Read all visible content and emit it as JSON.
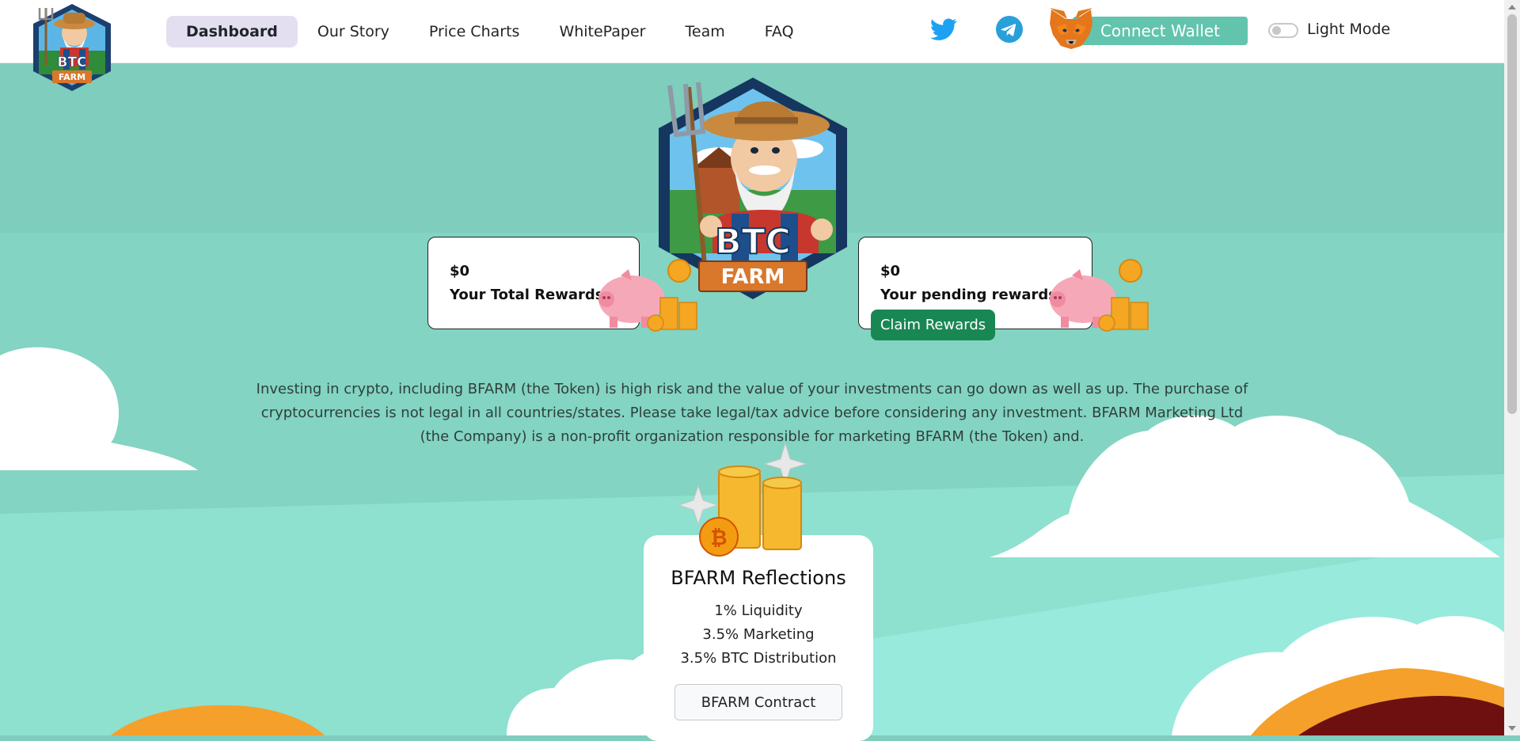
{
  "header": {
    "logo_text": {
      "line1": "BTC",
      "line2": "FARM"
    },
    "nav": [
      {
        "label": "Dashboard",
        "active": true
      },
      {
        "label": "Our Story"
      },
      {
        "label": "Price Charts"
      },
      {
        "label": "WhitePaper"
      },
      {
        "label": "Team"
      },
      {
        "label": "FAQ"
      }
    ],
    "social": [
      "twitter-icon",
      "telegram-icon"
    ],
    "connect_wallet": "Connect Wallet",
    "theme_toggle_label": "Light Mode"
  },
  "hero": {
    "logo_text": {
      "line1": "BTC",
      "line2": "FARM"
    }
  },
  "rewards": {
    "total": {
      "amount": "$0",
      "label": "Your Total Rewards"
    },
    "pending": {
      "amount": "$0",
      "label": "Your pending rewards"
    },
    "claim_label": "Claim Rewards"
  },
  "disclaimer": "Investing in crypto, including BFARM (the Token) is high risk and the value of your investments can go down as well as up. The purchase of cryptocurrencies is not legal in all countries/states. Please take legal/tax advice before considering any investment. BFARM Marketing Ltd (the Company) is a non-profit organization responsible for marketing BFARM (the Token) and.",
  "reflections": {
    "title": "BFARM Reflections",
    "lines": [
      "1% Liquidity",
      "3.5% Marketing",
      "3.5% BTC Distribution"
    ],
    "contract_label": "BFARM Contract"
  },
  "colors": {
    "background": "#7ecdbd",
    "wallet_button": "#62c4ad",
    "claim_button": "#198754",
    "nav_active": "#e3dff0"
  }
}
